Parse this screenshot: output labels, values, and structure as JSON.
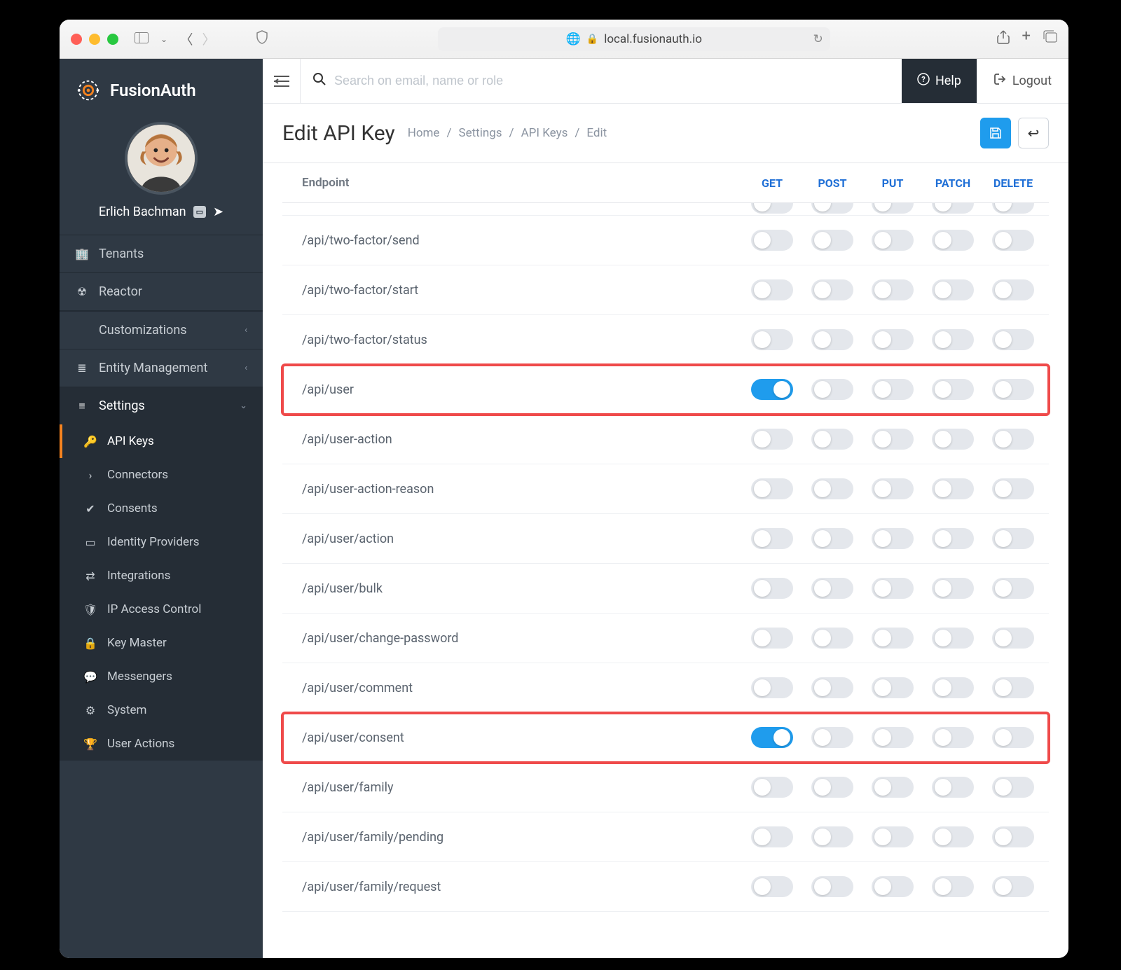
{
  "browser": {
    "address": "local.fusionauth.io"
  },
  "brand": "FusionAuth",
  "user": {
    "name": "Erlich Bachman"
  },
  "sidebar": {
    "top": [
      {
        "icon": "building-icon",
        "label": "Tenants"
      },
      {
        "icon": "atom-icon",
        "label": "Reactor"
      }
    ],
    "groups": [
      {
        "icon": "code-icon",
        "label": "Customizations",
        "expanded": false
      },
      {
        "icon": "layers-icon",
        "label": "Entity Management",
        "expanded": false
      },
      {
        "icon": "sliders-icon",
        "label": "Settings",
        "expanded": true,
        "children": [
          {
            "icon": "key-icon",
            "label": "API Keys",
            "active": true
          },
          {
            "icon": "chevron-right-icon",
            "label": "Connectors"
          },
          {
            "icon": "check-icon",
            "label": "Consents"
          },
          {
            "icon": "id-card-icon",
            "label": "Identity Providers"
          },
          {
            "icon": "exchange-icon",
            "label": "Integrations"
          },
          {
            "icon": "shield-icon",
            "label": "IP Access Control"
          },
          {
            "icon": "lock-icon",
            "label": "Key Master"
          },
          {
            "icon": "chat-icon",
            "label": "Messengers"
          },
          {
            "icon": "gear-icon",
            "label": "System"
          },
          {
            "icon": "trophy-icon",
            "label": "User Actions"
          }
        ]
      }
    ]
  },
  "topbar": {
    "search_placeholder": "Search on email, name or role",
    "help_label": "Help",
    "logout_label": "Logout"
  },
  "page": {
    "title": "Edit API Key",
    "breadcrumbs": [
      "Home",
      "Settings",
      "API Keys",
      "Edit"
    ]
  },
  "table": {
    "header_endpoint": "Endpoint",
    "columns": [
      "GET",
      "POST",
      "PUT",
      "PATCH",
      "DELETE"
    ],
    "rows": [
      {
        "endpoint": "/api/two-factor/send",
        "toggles": [
          false,
          false,
          false,
          false,
          false
        ],
        "highlight": false
      },
      {
        "endpoint": "/api/two-factor/start",
        "toggles": [
          false,
          false,
          false,
          false,
          false
        ],
        "highlight": false
      },
      {
        "endpoint": "/api/two-factor/status",
        "toggles": [
          false,
          false,
          false,
          false,
          false
        ],
        "highlight": false
      },
      {
        "endpoint": "/api/user",
        "toggles": [
          true,
          false,
          false,
          false,
          false
        ],
        "highlight": true
      },
      {
        "endpoint": "/api/user-action",
        "toggles": [
          false,
          false,
          false,
          false,
          false
        ],
        "highlight": false
      },
      {
        "endpoint": "/api/user-action-reason",
        "toggles": [
          false,
          false,
          false,
          false,
          false
        ],
        "highlight": false
      },
      {
        "endpoint": "/api/user/action",
        "toggles": [
          false,
          false,
          false,
          false,
          false
        ],
        "highlight": false
      },
      {
        "endpoint": "/api/user/bulk",
        "toggles": [
          false,
          false,
          false,
          false,
          false
        ],
        "highlight": false
      },
      {
        "endpoint": "/api/user/change-password",
        "toggles": [
          false,
          false,
          false,
          false,
          false
        ],
        "highlight": false
      },
      {
        "endpoint": "/api/user/comment",
        "toggles": [
          false,
          false,
          false,
          false,
          false
        ],
        "highlight": false
      },
      {
        "endpoint": "/api/user/consent",
        "toggles": [
          true,
          false,
          false,
          false,
          false
        ],
        "highlight": true
      },
      {
        "endpoint": "/api/user/family",
        "toggles": [
          false,
          false,
          false,
          false,
          false
        ],
        "highlight": false
      },
      {
        "endpoint": "/api/user/family/pending",
        "toggles": [
          false,
          false,
          false,
          false,
          false
        ],
        "highlight": false
      },
      {
        "endpoint": "/api/user/family/request",
        "toggles": [
          false,
          false,
          false,
          false,
          false
        ],
        "highlight": false
      }
    ]
  },
  "colors": {
    "accent": "#f58320",
    "primary": "#1f9ced",
    "highlight": "#ef4a4a"
  }
}
